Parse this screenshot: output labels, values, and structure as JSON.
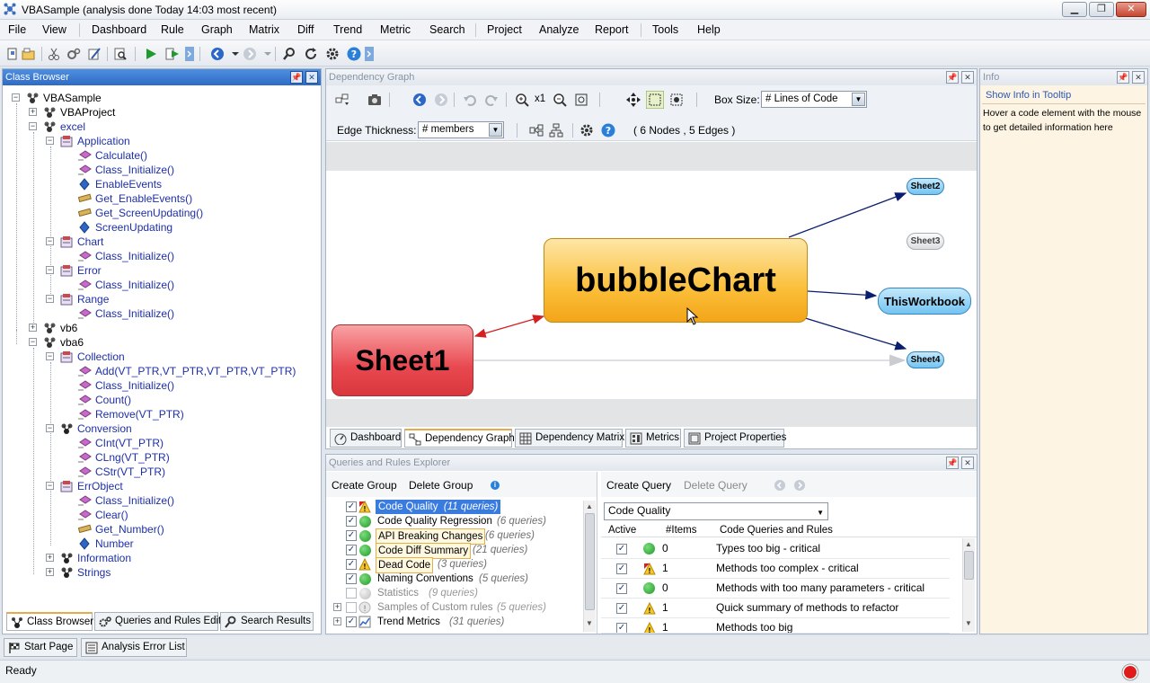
{
  "window": {
    "title": "VBASample  (analysis done Today 14:03 most recent)",
    "min": "▁",
    "max": "❐",
    "close": "✕"
  },
  "menu": [
    "File",
    "View",
    "Dashboard",
    "Rule",
    "Graph",
    "Matrix",
    "Diff",
    "Trend",
    "Metric",
    "Search",
    "Project",
    "Analyze",
    "Report",
    "Tools",
    "Help"
  ],
  "class_browser": {
    "title": "Class Browser",
    "pin": "📌",
    "close": "✕",
    "items": [
      "VBASample",
      "VBAProject",
      "excel",
      "Application",
      "Calculate()",
      "Class_Initialize()",
      "EnableEvents",
      "Get_EnableEvents()",
      "Get_ScreenUpdating()",
      "ScreenUpdating",
      "Chart",
      "Class_Initialize()",
      "Error",
      "Class_Initialize()",
      "Range",
      "Class_Initialize()",
      "vb6",
      "vba6",
      "Collection",
      "Add(VT_PTR,VT_PTR,VT_PTR,VT_PTR)",
      "Class_Initialize()",
      "Count()",
      "Remove(VT_PTR)",
      "Conversion",
      "CInt(VT_PTR)",
      "CLng(VT_PTR)",
      "CStr(VT_PTR)",
      "ErrObject",
      "Class_Initialize()",
      "Clear()",
      "Get_Number()",
      "Number",
      "Information",
      "Strings"
    ],
    "tabs": [
      "Class Browser",
      "Queries and Rules Edit",
      "Search Results"
    ]
  },
  "dependency_graph": {
    "title": "Dependency Graph",
    "x1": "x1",
    "box_size_label": "Box Size:",
    "box_size_value": "# Lines of Code",
    "edge_thickness_label": "Edge Thickness:",
    "edge_thickness_value": "# members",
    "summary": "( 6 Nodes , 5 Edges )",
    "nodes": {
      "bubble": "bubbleChart",
      "sheet1": "Sheet1",
      "sheet2": "Sheet2",
      "sheet3": "Sheet3",
      "thisworkbook": "ThisWorkbook",
      "sheet4": "Sheet4"
    },
    "tabs": [
      "Dashboard",
      "Dependency Graph",
      "Dependency Matrix",
      "Metrics",
      "Project Properties"
    ]
  },
  "info": {
    "title": "Info",
    "link": "Show Info in Tooltip",
    "text": "Hover a code element with the mouse to get detailed information here"
  },
  "queries": {
    "title": "Queries and Rules Explorer",
    "create_group": "Create Group",
    "delete_group": "Delete Group",
    "info_glyph": "i",
    "groups": [
      {
        "name": "Code Quality",
        "count": "(11 queries)",
        "status": "warn-error"
      },
      {
        "name": "Code Quality Regression",
        "count": "(6 queries)",
        "status": "ok"
      },
      {
        "name": "API Breaking Changes",
        "count": "(6 queries)",
        "status": "ok"
      },
      {
        "name": "Code Diff Summary",
        "count": "(21 queries)",
        "status": "ok"
      },
      {
        "name": "Dead Code",
        "count": "(3 queries)",
        "status": "warn"
      },
      {
        "name": "Naming Conventions",
        "count": "(5 queries)",
        "status": "ok"
      },
      {
        "name": "Statistics",
        "count": "(9 queries)",
        "status": "none"
      },
      {
        "name": "Samples of Custom rules",
        "count": "(5 queries)",
        "status": "info"
      },
      {
        "name": "Trend Metrics",
        "count": "(31 queries)",
        "status": "trend"
      }
    ],
    "create_query": "Create Query",
    "delete_query": "Delete Query",
    "group_select": "Code Quality",
    "columns": [
      "Active",
      "#Items",
      "Code Queries and Rules"
    ],
    "rows": [
      {
        "status": "ok",
        "items": "0",
        "name": "Types too big - critical"
      },
      {
        "status": "warn-error",
        "items": "1",
        "name": "Methods too complex - critical"
      },
      {
        "status": "ok",
        "items": "0",
        "name": "Methods with too many parameters - critical"
      },
      {
        "status": "warn",
        "items": "1",
        "name": "Quick summary of methods to refactor"
      },
      {
        "status": "warn",
        "items": "1",
        "name": "Methods too big"
      }
    ]
  },
  "bottom_tabs": [
    "Start Page",
    "Analysis Error List"
  ],
  "status": {
    "text": "Ready"
  },
  "colors": {
    "accent": "#2f6bc5",
    "bubble": "#fbbf3a",
    "sheet1": "#e8484f",
    "node_blue": "#74c4f1"
  }
}
